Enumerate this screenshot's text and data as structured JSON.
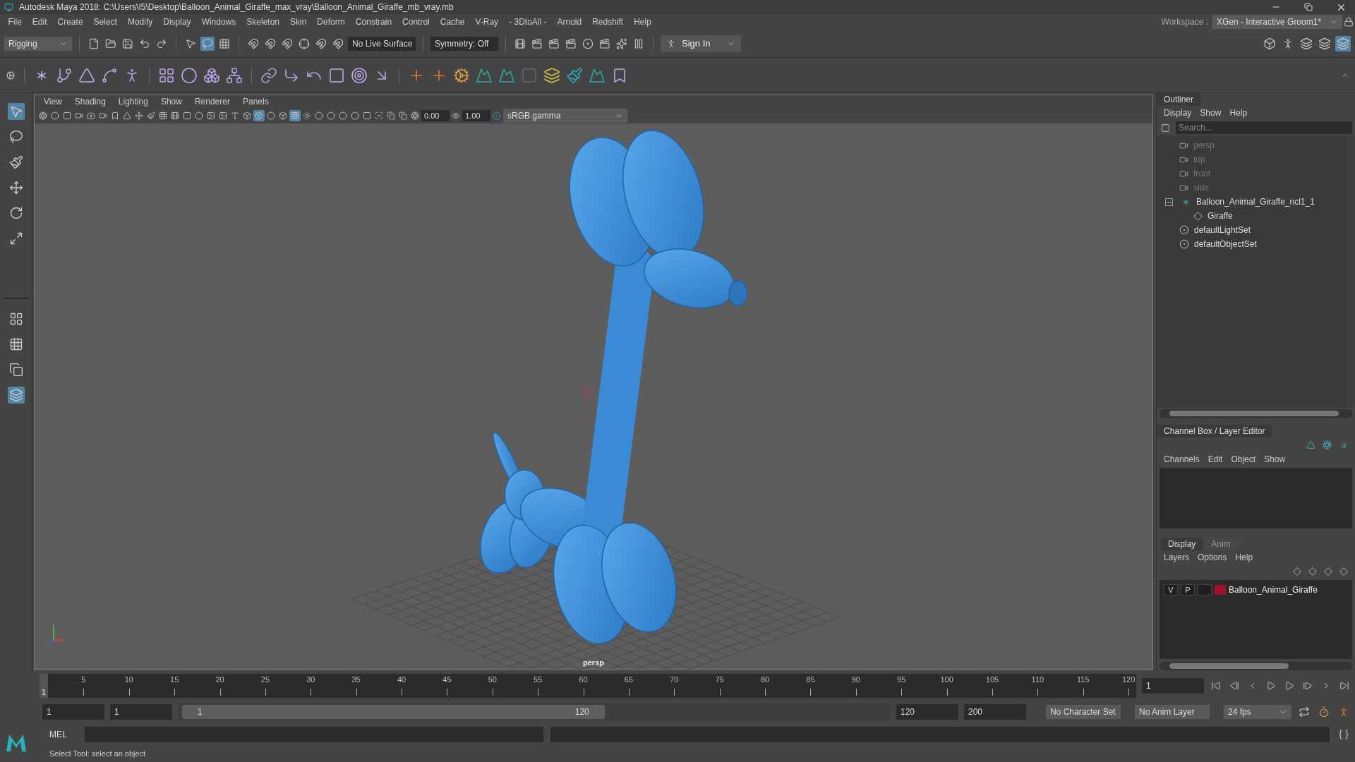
{
  "window": {
    "title": "Autodesk Maya 2018: C:\\Users\\I5\\Desktop\\Balloon_Animal_Giraffe_max_vray\\Balloon_Animal_Giraffe_mb_vray.mb"
  },
  "menu_bar": {
    "items": [
      "File",
      "Edit",
      "Create",
      "Select",
      "Modify",
      "Display",
      "Windows",
      "Skeleton",
      "Skin",
      "Deform",
      "Constrain",
      "Control",
      "Cache",
      "V-Ray",
      "- 3DtoAll -",
      "Arnold",
      "Redshift",
      "Help"
    ],
    "workspace_label": "Workspace :",
    "workspace": "XGen - Interactive Groom1*"
  },
  "status_line": {
    "menu_set": "Rigging",
    "live_surface": "No Live Surface",
    "symmetry": "Symmetry: Off",
    "sign_in": "Sign In"
  },
  "viewport": {
    "menus": [
      "View",
      "Shading",
      "Lighting",
      "Show",
      "Renderer",
      "Panels"
    ],
    "exposure": "0.00",
    "gamma": "1.00",
    "color_space": "sRGB gamma",
    "camera": "persp"
  },
  "outliner": {
    "title": "Outliner",
    "menus": [
      "Display",
      "Show",
      "Help"
    ],
    "search": {
      "placeholder": "Search..."
    },
    "items": [
      {
        "label": "persp",
        "kind": "camera",
        "dimmed": true
      },
      {
        "label": "top",
        "kind": "camera",
        "dimmed": true
      },
      {
        "label": "front",
        "kind": "camera",
        "dimmed": true
      },
      {
        "label": "side",
        "kind": "camera",
        "dimmed": true
      },
      {
        "label": "Balloon_Animal_Giraffe_ncl1_1",
        "kind": "group",
        "dimmed": false,
        "expanded": true,
        "children": [
          {
            "label": "Giraffe",
            "kind": "mesh",
            "dimmed": false
          }
        ]
      },
      {
        "label": "defaultLightSet",
        "kind": "set",
        "dimmed": false
      },
      {
        "label": "defaultObjectSet",
        "kind": "set",
        "dimmed": false
      }
    ]
  },
  "channel_box": {
    "title": "Channel Box / Layer Editor",
    "menus": [
      "Channels",
      "Edit",
      "Object",
      "Show"
    ]
  },
  "layer_editor": {
    "tabs": [
      {
        "label": "Display",
        "selected": true
      },
      {
        "label": "Anim",
        "selected": false
      }
    ],
    "menus": [
      "Layers",
      "Options",
      "Help"
    ],
    "layers": [
      {
        "visible": "V",
        "playback": "P",
        "color": "#a0102c",
        "name": "Balloon_Animal_Giraffe"
      }
    ]
  },
  "time_slider": {
    "level": 0,
    "current": "1",
    "ticks": [
      "5",
      "10",
      "15",
      "20",
      "25",
      "30",
      "35",
      "40",
      "45",
      "50",
      "55",
      "60",
      "65",
      "70",
      "75",
      "80",
      "85",
      "90",
      "95",
      "100",
      "105",
      "110",
      "115",
      "120"
    ],
    "current_field": "1"
  },
  "range_slider": {
    "level": 0.6,
    "start": "1",
    "playback_start": "1",
    "range_start": "1",
    "range_end": "120",
    "playback_end": "120",
    "end": "200",
    "character_set": "No Character Set",
    "anim_layer": "No Anim Layer",
    "fps": "24 fps"
  },
  "command_line": {
    "label": "MEL"
  },
  "help_line": {
    "text": "Select Tool: select an object"
  }
}
